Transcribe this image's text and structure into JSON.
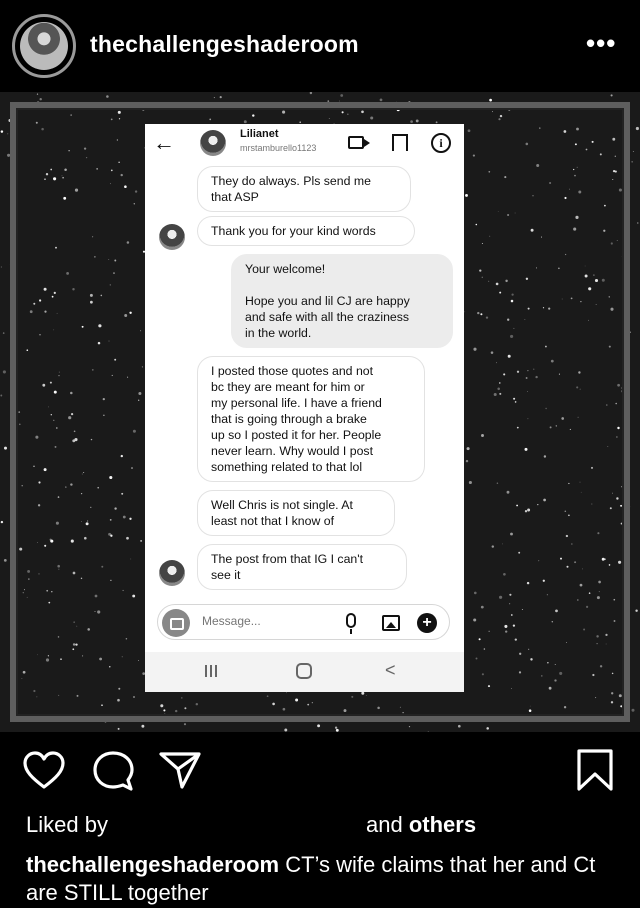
{
  "header": {
    "username": "thechallengeshaderoom",
    "more_label": "•••"
  },
  "dm": {
    "back_label": "←",
    "name": "Lilianet",
    "handle": "mrstamburello1123",
    "info_label": "i",
    "messages": [
      {
        "text": "They do always. Pls send me\nthat ASP",
        "from": "them"
      },
      {
        "text": "Thank you for your kind words",
        "from": "them"
      },
      {
        "text": "Your welcome!\n\nHope you and lil CJ are happy\nand safe with all the craziness\nin the world.",
        "from": "me"
      },
      {
        "text": "I posted those quotes and not\nbc they are meant for him or\nmy personal life. I have a friend\nthat is going through a brake\nup so I posted it for her. People\nnever learn. Why would I post\nsomething related to that lol",
        "from": "them"
      },
      {
        "text": "Well Chris is not single. At\nleast not that I know of",
        "from": "them"
      },
      {
        "text": "The post from that IG I can't\nsee it",
        "from": "them"
      }
    ],
    "composer_placeholder": "Message...",
    "plus_label": "+",
    "nav_back_label": "<"
  },
  "post_footer": {
    "liked_by": "Liked by",
    "and_label": "and",
    "others_label": "others",
    "caption_user": "thechallengeshaderoom",
    "caption_text": " CT’s wife claims that her and Ct are STILL together"
  },
  "colors": {
    "background": "#000000",
    "frame": "#5e5e5e",
    "my_bubble": "#ececec"
  }
}
